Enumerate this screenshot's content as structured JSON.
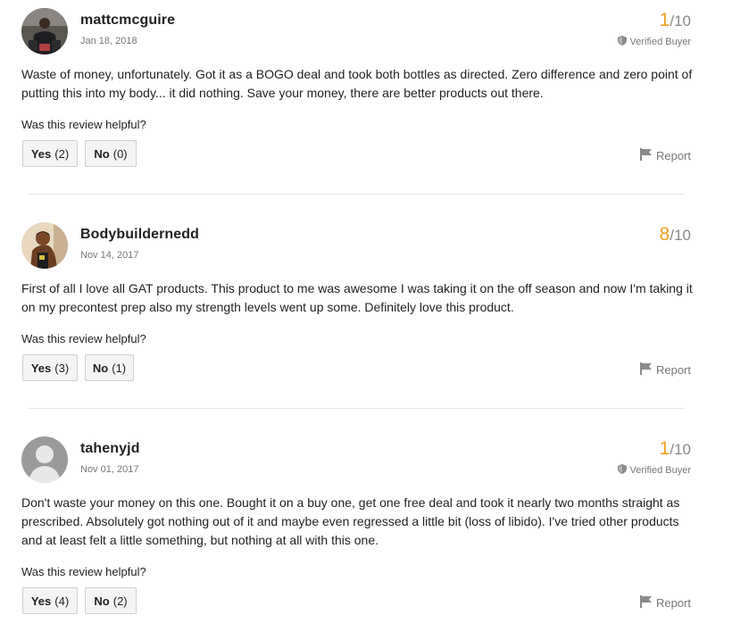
{
  "reviews": [
    {
      "username": "mattcmcguire",
      "date": "Jan 18, 2018",
      "score": "1",
      "out_of": "/10",
      "verified": "Verified Buyer",
      "body": "Waste of money, unfortunately. Got it as a BOGO deal and took both bottles as directed. Zero difference and zero point of putting this into my body... it did nothing. Save your money, there are better products out there.",
      "helpful_question": "Was this review helpful?",
      "yes_label": "Yes",
      "yes_count": "(2)",
      "no_label": "No",
      "no_count": "(0)",
      "report_label": "Report"
    },
    {
      "username": "Bodybuildernedd",
      "date": "Nov 14, 2017",
      "score": "8",
      "out_of": "/10",
      "body": "First of all I love all GAT products. This product to me was awesome I was taking it on the off season and now I'm taking it on my precontest prep also my strength levels went up some. Definitely love this product.",
      "helpful_question": "Was this review helpful?",
      "yes_label": "Yes",
      "yes_count": "(3)",
      "no_label": "No",
      "no_count": "(1)",
      "report_label": "Report"
    },
    {
      "username": "tahenyjd",
      "date": "Nov 01, 2017",
      "score": "1",
      "out_of": "/10",
      "verified": "Verified Buyer",
      "body": "Don't waste your money on this one. Bought it on a buy one, get one free deal and took it nearly two months straight as prescribed. Absolutely got nothing out of it and maybe even regressed a little bit (loss of libido). I've tried other products and at least felt a little something, but nothing at all with this one.",
      "helpful_question": "Was this review helpful?",
      "yes_label": "Yes",
      "yes_count": "(4)",
      "no_label": "No",
      "no_count": "(2)",
      "report_label": "Report"
    }
  ],
  "colors": {
    "score_accent": "#f0a020",
    "muted_text": "#777777",
    "button_bg": "#f4f4f4",
    "divider": "#e3e3e3"
  },
  "icons": {
    "verified": "shield-icon",
    "report": "flag-icon",
    "avatar_placeholder": "default-user-avatar-icon"
  }
}
